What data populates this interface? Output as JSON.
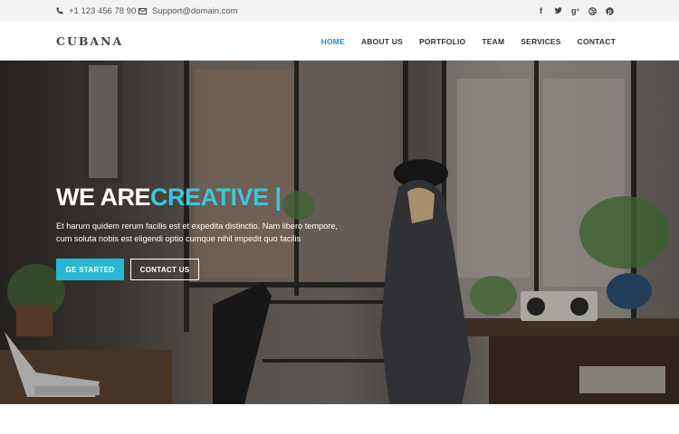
{
  "topbar": {
    "phone": "+1 123 456 78 90",
    "email": "Support@domain.com",
    "social_icons": [
      "facebook-icon",
      "twitter-icon",
      "google-plus-icon",
      "dribbble-icon",
      "pinterest-icon"
    ]
  },
  "nav": {
    "logo": "CUBANA",
    "items": [
      {
        "label": "HOME",
        "active": true
      },
      {
        "label": "ABOUT US",
        "active": false
      },
      {
        "label": "PORTFOLIO",
        "active": false
      },
      {
        "label": "TEAM",
        "active": false
      },
      {
        "label": "SERVICES",
        "active": false
      },
      {
        "label": "CONTACT",
        "active": false
      }
    ]
  },
  "hero": {
    "headline_1": "WE ARE",
    "headline_2": "CREATIVE |",
    "subtext": "Et harum quidem rerum facilis est et expedita distinctio. Nam libero tempore, cum soluta nobis est eligendi optio cumque nihil impedit quo facilis",
    "primary_button": "GE STARTED",
    "secondary_button": "CONTACT US"
  },
  "colors": {
    "accent": "#29b7d4",
    "active_nav": "#2a8fbf"
  }
}
